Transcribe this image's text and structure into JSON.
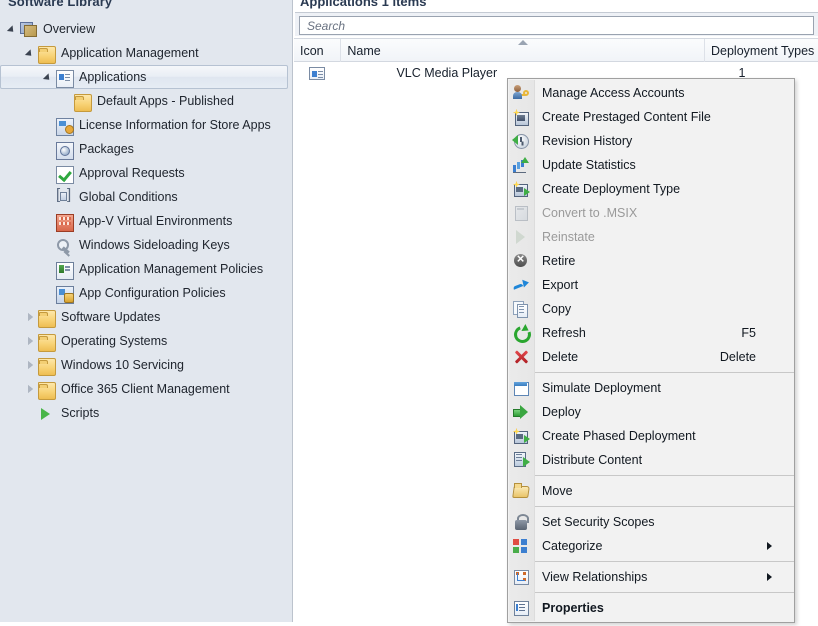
{
  "nav": {
    "title": "Software Library",
    "items": [
      {
        "label": "Overview",
        "icon": "overview-icon",
        "indent": 0,
        "twist": "expanded",
        "selected": false
      },
      {
        "label": "Application Management",
        "icon": "folder-icon",
        "indent": 1,
        "twist": "expanded",
        "selected": false
      },
      {
        "label": "Applications",
        "icon": "application-icon",
        "indent": 2,
        "twist": "expanded",
        "selected": true
      },
      {
        "label": "Default Apps - Published",
        "icon": "folder-icon",
        "indent": 3,
        "twist": "none",
        "selected": false
      },
      {
        "label": "License Information for Store Apps",
        "icon": "license-icon",
        "indent": 2,
        "twist": "none",
        "selected": false
      },
      {
        "label": "Packages",
        "icon": "package-icon",
        "indent": 2,
        "twist": "none",
        "selected": false
      },
      {
        "label": "Approval Requests",
        "icon": "approval-icon",
        "indent": 2,
        "twist": "none",
        "selected": false
      },
      {
        "label": "Global Conditions",
        "icon": "global-conditions-icon",
        "indent": 2,
        "twist": "none",
        "selected": false
      },
      {
        "label": "App-V Virtual Environments",
        "icon": "appv-icon",
        "indent": 2,
        "twist": "none",
        "selected": false
      },
      {
        "label": "Windows Sideloading Keys",
        "icon": "key-icon",
        "indent": 2,
        "twist": "none",
        "selected": false
      },
      {
        "label": "Application Management Policies",
        "icon": "policy-icon",
        "indent": 2,
        "twist": "none",
        "selected": false
      },
      {
        "label": "App Configuration Policies",
        "icon": "app-config-icon",
        "indent": 2,
        "twist": "none",
        "selected": false
      },
      {
        "label": "Software Updates",
        "icon": "folder-icon",
        "indent": 1,
        "twist": "collapsed",
        "selected": false
      },
      {
        "label": "Operating Systems",
        "icon": "folder-icon",
        "indent": 1,
        "twist": "collapsed",
        "selected": false
      },
      {
        "label": "Windows 10 Servicing",
        "icon": "folder-icon",
        "indent": 1,
        "twist": "collapsed",
        "selected": false
      },
      {
        "label": "Office 365 Client Management",
        "icon": "folder-icon",
        "indent": 1,
        "twist": "collapsed",
        "selected": false
      },
      {
        "label": "Scripts",
        "icon": "script-icon",
        "indent": 1,
        "twist": "none",
        "selected": false
      }
    ]
  },
  "content": {
    "title": "Applications 1 items",
    "search": {
      "value": "",
      "placeholder": "Search"
    },
    "list": {
      "columns": [
        {
          "label": "Icon",
          "sorted": false
        },
        {
          "label": "Name",
          "sorted": true,
          "sort_direction": "ascending"
        },
        {
          "label": "Deployment Types",
          "sorted": false
        }
      ],
      "rows": [
        {
          "icon": "application-icon",
          "name": "VLC Media Player",
          "deployment_types": "1"
        }
      ]
    }
  },
  "context_menu": {
    "items": [
      {
        "label": "Manage Access Accounts",
        "icon": "manage-access-accounts-icon",
        "accel": "",
        "disabled": false,
        "bold": false,
        "submenu": false,
        "separator_after": false
      },
      {
        "label": "Create Prestaged Content File",
        "icon": "create-prestaged-content-icon",
        "accel": "",
        "disabled": false,
        "bold": false,
        "submenu": false,
        "separator_after": false
      },
      {
        "label": "Revision History",
        "icon": "revision-history-icon",
        "accel": "",
        "disabled": false,
        "bold": false,
        "submenu": false,
        "separator_after": false
      },
      {
        "label": "Update Statistics",
        "icon": "update-statistics-icon",
        "accel": "",
        "disabled": false,
        "bold": false,
        "submenu": false,
        "separator_after": false
      },
      {
        "label": "Create Deployment Type",
        "icon": "create-deployment-type-icon",
        "accel": "",
        "disabled": false,
        "bold": false,
        "submenu": false,
        "separator_after": false
      },
      {
        "label": "Convert to .MSIX",
        "icon": "convert-to-msix-icon",
        "accel": "",
        "disabled": true,
        "bold": false,
        "submenu": false,
        "separator_after": false
      },
      {
        "label": "Reinstate",
        "icon": "reinstate-icon",
        "accel": "",
        "disabled": true,
        "bold": false,
        "submenu": false,
        "separator_after": false
      },
      {
        "label": "Retire",
        "icon": "retire-icon",
        "accel": "",
        "disabled": false,
        "bold": false,
        "submenu": false,
        "separator_after": false
      },
      {
        "label": "Export",
        "icon": "export-icon",
        "accel": "",
        "disabled": false,
        "bold": false,
        "submenu": false,
        "separator_after": false
      },
      {
        "label": "Copy",
        "icon": "copy-icon",
        "accel": "",
        "disabled": false,
        "bold": false,
        "submenu": false,
        "separator_after": false
      },
      {
        "label": "Refresh",
        "icon": "refresh-icon",
        "accel": "F5",
        "disabled": false,
        "bold": false,
        "submenu": false,
        "separator_after": false
      },
      {
        "label": "Delete",
        "icon": "delete-icon",
        "accel": "Delete",
        "disabled": false,
        "bold": false,
        "submenu": false,
        "separator_after": true
      },
      {
        "label": "Simulate Deployment",
        "icon": "simulate-deployment-icon",
        "accel": "",
        "disabled": false,
        "bold": false,
        "submenu": false,
        "separator_after": false
      },
      {
        "label": "Deploy",
        "icon": "deploy-icon",
        "accel": "",
        "disabled": false,
        "bold": false,
        "submenu": false,
        "separator_after": false
      },
      {
        "label": "Create Phased Deployment",
        "icon": "create-phased-deployment-icon",
        "accel": "",
        "disabled": false,
        "bold": false,
        "submenu": false,
        "separator_after": false
      },
      {
        "label": "Distribute Content",
        "icon": "distribute-content-icon",
        "accel": "",
        "disabled": false,
        "bold": false,
        "submenu": false,
        "separator_after": true
      },
      {
        "label": "Move",
        "icon": "move-icon",
        "accel": "",
        "disabled": false,
        "bold": false,
        "submenu": false,
        "separator_after": true
      },
      {
        "label": "Set Security Scopes",
        "icon": "set-security-scopes-icon",
        "accel": "",
        "disabled": false,
        "bold": false,
        "submenu": false,
        "separator_after": false
      },
      {
        "label": "Categorize",
        "icon": "categorize-icon",
        "accel": "",
        "disabled": false,
        "bold": false,
        "submenu": true,
        "separator_after": true
      },
      {
        "label": "View Relationships",
        "icon": "view-relationships-icon",
        "accel": "",
        "disabled": false,
        "bold": false,
        "submenu": true,
        "separator_after": true
      },
      {
        "label": "Properties",
        "icon": "properties-icon",
        "accel": "",
        "disabled": false,
        "bold": true,
        "submenu": false,
        "separator_after": false
      }
    ]
  },
  "colors": {
    "nav_background": "#e2e7ee",
    "content_background": "#ffffff",
    "menu_background": "#f2f2f2",
    "menu_border": "#a0a0a0",
    "selection_border": "#b6c2d2",
    "text": "#17202c",
    "disabled_text": "#9a9a9a",
    "title_text": "#2a3a52"
  }
}
